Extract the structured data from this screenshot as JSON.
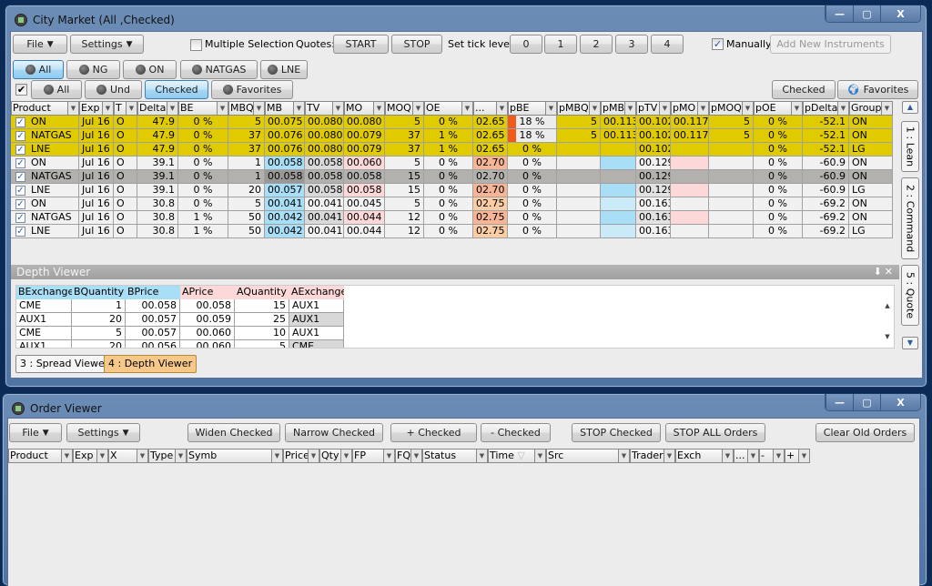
{
  "market": {
    "title": "City Market (All ,Checked)",
    "file": "File",
    "settings": "Settings",
    "multiple_selection": "Multiple Selection",
    "multiple_selection_checked": false,
    "quotes_label": "Quotes:",
    "start": "START",
    "stop": "STOP",
    "tick_label": "Set tick level",
    "ticks": [
      "0",
      "1",
      "2",
      "3",
      "4"
    ],
    "manually": "Manually",
    "manually_checked": true,
    "add_new": "Add New Instruments",
    "group_filters": [
      "All",
      "NG",
      "ON",
      "NATGAS",
      "LNE"
    ],
    "group_selected": "All",
    "view_filters": [
      "All",
      "Und",
      "Checked",
      "Favorites"
    ],
    "view_selected": "Checked",
    "right_checked": "Checked",
    "right_favorites": "Favorites",
    "columns": [
      "Product",
      "Exp",
      "T",
      "Delta",
      "BE",
      "MBQ",
      "MB",
      "TV",
      "MO",
      "MOQ",
      "OE",
      "...",
      "pBE",
      "pMBQ",
      "pMB",
      "pTV",
      "pMO",
      "pMOQ",
      "pOE",
      "pDelta",
      "Group"
    ],
    "rows": [
      {
        "style": "yellow",
        "checked": true,
        "v": [
          "ON",
          "Jul 16",
          "O",
          "47.9",
          "0 %",
          "5",
          "00.075",
          "00.080",
          "00.080",
          "5",
          "0 %",
          "02.65",
          "18 %",
          "5",
          "00.113",
          "00.102",
          "00.117",
          "5",
          "0 %",
          "-52.1",
          "ON"
        ],
        "colors": {
          "12": "#f05a1a"
        }
      },
      {
        "style": "yellow",
        "checked": true,
        "v": [
          "NATGAS",
          "Jul 16",
          "O",
          "47.9",
          "0 %",
          "37",
          "00.076",
          "00.080",
          "00.079",
          "37",
          "1 %",
          "02.65",
          "18 %",
          "5",
          "00.113",
          "00.102",
          "00.117",
          "5",
          "0 %",
          "-52.1",
          "ON"
        ],
        "colors": {
          "12": "#f05a1a"
        }
      },
      {
        "style": "yellow",
        "checked": true,
        "v": [
          "LNE",
          "Jul 16",
          "O",
          "47.9",
          "0 %",
          "37",
          "00.076",
          "00.080",
          "00.079",
          "37",
          "1 %",
          "02.65",
          "0 %",
          "",
          "",
          "00.102",
          "",
          "",
          "0 %",
          "-52.1",
          "LG"
        ],
        "colors": {}
      },
      {
        "style": "plain",
        "checked": true,
        "v": [
          "ON",
          "Jul 16",
          "O",
          "39.1",
          "0 %",
          "1",
          "00.058",
          "00.058",
          "00.060",
          "5",
          "0 %",
          "02.70",
          "0 %",
          "",
          "",
          "00.129",
          "",
          "",
          "0 %",
          "-60.9",
          "ON"
        ],
        "colors": {
          "6": "#a9def7",
          "7": "#d9d9d9",
          "8": "#fcd8d8",
          "11": "#f6b597",
          "14": "#a9def7",
          "16": "#fcd8d8"
        }
      },
      {
        "style": "selrow",
        "checked": true,
        "v": [
          "NATGAS",
          "Jul 16",
          "O",
          "39.1",
          "0 %",
          "1",
          "00.058",
          "00.058",
          "00.058",
          "15",
          "0 %",
          "02.70",
          "0 %",
          "",
          "",
          "00.129",
          "",
          "",
          "0 %",
          "-60.9",
          "ON"
        ],
        "colors": {
          "6": "#999896"
        }
      },
      {
        "style": "plain",
        "checked": true,
        "v": [
          "LNE",
          "Jul 16",
          "O",
          "39.1",
          "0 %",
          "20",
          "00.057",
          "00.058",
          "00.058",
          "15",
          "0 %",
          "02.70",
          "0 %",
          "",
          "",
          "00.129",
          "",
          "",
          "0 %",
          "-60.9",
          "LG"
        ],
        "colors": {
          "6": "#a9def7",
          "7": "#d9d9d9",
          "8": "#fcd8d8",
          "11": "#f6b597",
          "14": "#a9def7",
          "15": "#e2e2e2",
          "16": "#fcd8d8"
        }
      },
      {
        "style": "plain",
        "checked": true,
        "v": [
          "ON",
          "Jul 16",
          "O",
          "30.8",
          "0 %",
          "5",
          "00.041",
          "00.041",
          "00.045",
          "5",
          "0 %",
          "02.75",
          "0 %",
          "",
          "",
          "00.163",
          "",
          "",
          "0 %",
          "-69.2",
          "ON"
        ],
        "colors": {
          "6": "#a9def7",
          "11": "#fbcda6",
          "14": "#cbeaf7"
        }
      },
      {
        "style": "plain",
        "checked": true,
        "v": [
          "NATGAS",
          "Jul 16",
          "O",
          "30.8",
          "1 %",
          "50",
          "00.042",
          "00.041",
          "00.044",
          "12",
          "0 %",
          "02.75",
          "0 %",
          "",
          "",
          "00.163",
          "",
          "",
          "0 %",
          "-69.2",
          "ON"
        ],
        "colors": {
          "6": "#a9def7",
          "7": "#d9d9d9",
          "8": "#fcd8d8",
          "11": "#f6b597",
          "14": "#a9def7",
          "15": "#e2e2e2",
          "16": "#fcd8d8"
        }
      },
      {
        "style": "plain",
        "checked": true,
        "v": [
          "LNE",
          "Jul 16",
          "O",
          "30.8",
          "1 %",
          "50",
          "00.042",
          "00.041",
          "00.044",
          "12",
          "0 %",
          "02.75",
          "0 %",
          "",
          "",
          "00.163",
          "",
          "",
          "0 %",
          "-69.2",
          "LG"
        ],
        "colors": {
          "6": "#a9def7",
          "11": "#fbcda6",
          "14": "#cbeaf7"
        }
      }
    ],
    "side_tabs": [
      "1 : Lean",
      "2 : Command",
      "5 : Quote"
    ],
    "depth": {
      "title": "Depth Viewer",
      "columns": [
        "BExchange",
        "BQuantity",
        "BPrice",
        "APrice",
        "AQuantity",
        "AExchange"
      ],
      "rows": [
        [
          "CME",
          "1",
          "00.058",
          "00.058",
          "15",
          "AUX1"
        ],
        [
          "AUX1",
          "20",
          "00.057",
          "00.059",
          "25",
          "AUX1"
        ],
        [
          "CME",
          "5",
          "00.057",
          "00.060",
          "10",
          "AUX1"
        ],
        [
          "AUX1",
          "20",
          "00.056",
          "00.060",
          "5",
          "CME"
        ]
      ]
    },
    "bottom_tabs": [
      "3 : Spread Viewer",
      "4 : Depth Viewer"
    ],
    "bottom_active": "4 : Depth Viewer"
  },
  "orders": {
    "title": "Order Viewer",
    "file": "File",
    "settings": "Settings",
    "buttons": [
      "Widen Checked",
      "Narrow Checked",
      "+ Checked",
      "- Checked",
      "STOP Checked",
      "STOP ALL Orders",
      "Clear Old Orders"
    ],
    "columns": [
      "Product",
      "Exp",
      "X",
      "Type",
      "Symb",
      "Price",
      "Qty",
      "FP",
      "FQ",
      "Status",
      "Time",
      "Src",
      "Trader",
      "Exch",
      "...",
      "-",
      "+"
    ]
  }
}
